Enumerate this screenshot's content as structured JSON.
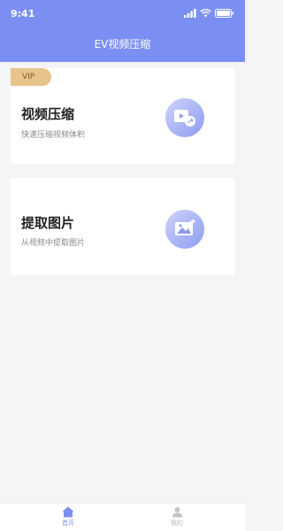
{
  "status": {
    "time": "9:41"
  },
  "header": {
    "title": "EV视频压缩"
  },
  "cards": [
    {
      "badge": "VIP",
      "title": "视频压缩",
      "subtitle": "快速压缩视频体积",
      "icon": "video-compress-icon"
    },
    {
      "title": "提取图片",
      "subtitle": "从视频中提取图片",
      "icon": "image-extract-icon"
    }
  ],
  "tabbar": {
    "items": [
      {
        "label": "首页",
        "icon": "home-icon",
        "active": true
      },
      {
        "label": "我的",
        "icon": "user-icon",
        "active": false
      }
    ]
  },
  "colors": {
    "accent": "#7b8ff3",
    "vip": "#e7c48b",
    "background": "#f4f5f7"
  }
}
